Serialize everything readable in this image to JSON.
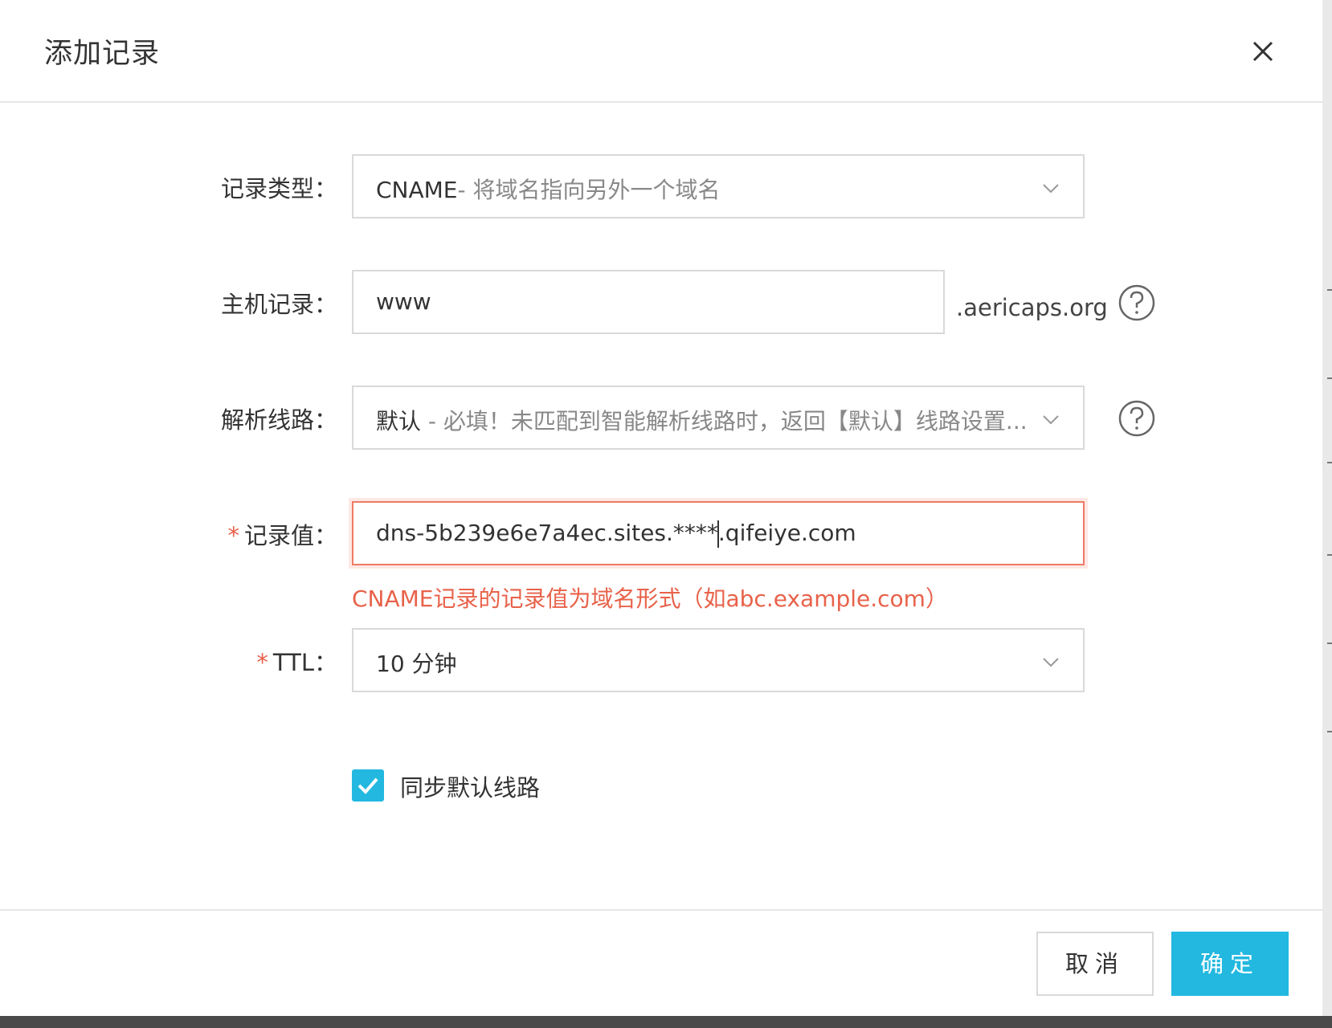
{
  "dialog": {
    "title": "添加记录"
  },
  "form": {
    "record_type": {
      "label": "记录类型：",
      "value_main": "CNAME",
      "value_desc": "- 将域名指向另外一个域名"
    },
    "host": {
      "label": "主机记录：",
      "value": "www",
      "suffix": ".aericaps.org"
    },
    "line": {
      "label": "解析线路：",
      "value_main": "默认",
      "value_desc": " - 必填！未匹配到智能解析线路时，返回【默认】线路设置..."
    },
    "record_value": {
      "required_mark": "*",
      "label": "记录值：",
      "value_before_caret": "dns-5b239e6e7a4ec.sites.****",
      "value_after_caret": ".qifeiye.com",
      "error": "CNAME记录的记录值为域名形式（如abc.example.com）"
    },
    "ttl": {
      "required_mark": "*",
      "label": "TTL：",
      "value": "10 分钟"
    },
    "sync": {
      "label": "同步默认线路",
      "checked": true
    }
  },
  "footer": {
    "cancel_label": "取消",
    "ok_label": "确定"
  },
  "colors": {
    "accent": "#22b8e0",
    "error": "#e8624a",
    "border": "#d9d9d9"
  }
}
